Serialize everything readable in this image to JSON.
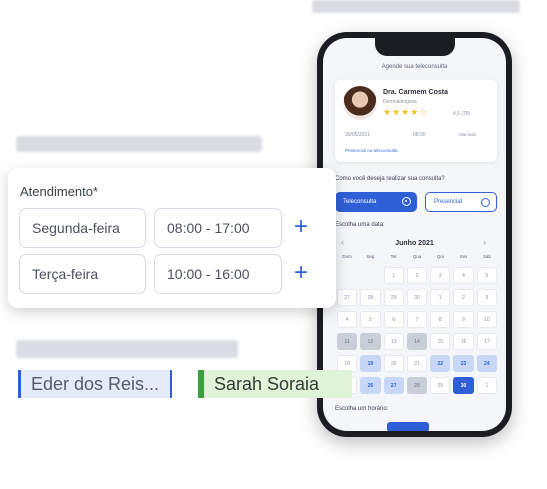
{
  "phone": {
    "screen_title": "Agende sua teleconsulta",
    "doctor": {
      "name": "Dra. Carmem Costa",
      "specialty": "Dermatologista",
      "stars": "★★★★☆",
      "rating": "4,5 (78)",
      "date": "30/05/2021",
      "time": "08:00",
      "status": "Marcado",
      "mode": "Presencial ou teleconsulta"
    },
    "question": "Como você deseja realizar sua consulta?",
    "option_tele": "Teleconsulta",
    "option_presencial": "Presencial",
    "pick_date": "Escolha uma data:",
    "month": "Junho 2021",
    "prev_icon": "chevron-left-icon",
    "next_icon": "chevron-right-icon",
    "weekdays": [
      "Dom",
      "Seg",
      "Ter",
      "Qua",
      "Qui",
      "Sex",
      "Sáb"
    ],
    "calendar": [
      {
        "d": "",
        "s": "empty"
      },
      {
        "d": "",
        "s": "empty"
      },
      {
        "d": "1",
        "s": "blank"
      },
      {
        "d": "2",
        "s": "blank"
      },
      {
        "d": "3",
        "s": "blank"
      },
      {
        "d": "4",
        "s": "blank"
      },
      {
        "d": "5",
        "s": "blank"
      },
      {
        "d": "27",
        "s": "blank"
      },
      {
        "d": "28",
        "s": "blank"
      },
      {
        "d": "29",
        "s": "blank"
      },
      {
        "d": "30",
        "s": "blank"
      },
      {
        "d": "1",
        "s": "blank"
      },
      {
        "d": "2",
        "s": "blank"
      },
      {
        "d": "3",
        "s": "blank"
      },
      {
        "d": "4",
        "s": "blank"
      },
      {
        "d": "5",
        "s": "blank"
      },
      {
        "d": "6",
        "s": "blank"
      },
      {
        "d": "7",
        "s": "blank"
      },
      {
        "d": "8",
        "s": "blank"
      },
      {
        "d": "9",
        "s": "blank"
      },
      {
        "d": "10",
        "s": "blank"
      },
      {
        "d": "11",
        "s": "grey"
      },
      {
        "d": "12",
        "s": "grey"
      },
      {
        "d": "13",
        "s": "blank"
      },
      {
        "d": "14",
        "s": "grey"
      },
      {
        "d": "15",
        "s": "blank"
      },
      {
        "d": "16",
        "s": "blank"
      },
      {
        "d": "17",
        "s": "blank"
      },
      {
        "d": "18",
        "s": "blank"
      },
      {
        "d": "19",
        "s": "blue"
      },
      {
        "d": "20",
        "s": "blank"
      },
      {
        "d": "21",
        "s": "blank"
      },
      {
        "d": "22",
        "s": "blue"
      },
      {
        "d": "23",
        "s": "blue"
      },
      {
        "d": "24",
        "s": "blue"
      },
      {
        "d": "25",
        "s": "blank"
      },
      {
        "d": "26",
        "s": "blue"
      },
      {
        "d": "27",
        "s": "blue"
      },
      {
        "d": "28",
        "s": "grey"
      },
      {
        "d": "29",
        "s": "blank"
      },
      {
        "d": "30",
        "s": "sel"
      },
      {
        "d": "1",
        "s": "blank"
      }
    ],
    "pick_time": "Escolha um horário:"
  },
  "schedule": {
    "title": "Atendimento*",
    "rows": [
      {
        "day": "Segunda-feira",
        "time": "08:00 - 17:00"
      },
      {
        "day": "Terça-feira",
        "time": "10:00 - 16:00"
      }
    ],
    "add_icon": "plus-icon"
  },
  "tags": {
    "first": "Eder dos Reis...",
    "second": "Sarah Soraia"
  },
  "colors": {
    "accent": "#2f5fd6",
    "star": "#f2c21b",
    "green": "#3aa238"
  }
}
